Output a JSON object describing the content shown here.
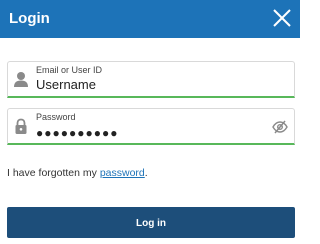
{
  "dialog": {
    "title": "Login"
  },
  "username_field": {
    "label": "Email or User ID",
    "value": "Username"
  },
  "password_field": {
    "label": "Password",
    "value": "●●●●●●●●●●"
  },
  "forgot": {
    "prefix": "I have forgotten my ",
    "link_text": "password",
    "suffix": "."
  },
  "login_button": {
    "label": "Log in"
  },
  "colors": {
    "header": "#1d73b8",
    "button": "#1d4e7a",
    "focus_underline": "#58b85a",
    "link": "#1d73b8"
  },
  "icons": {
    "close": "close-icon",
    "user": "user-icon",
    "lock": "lock-icon",
    "visibility": "visibility-off-icon"
  }
}
